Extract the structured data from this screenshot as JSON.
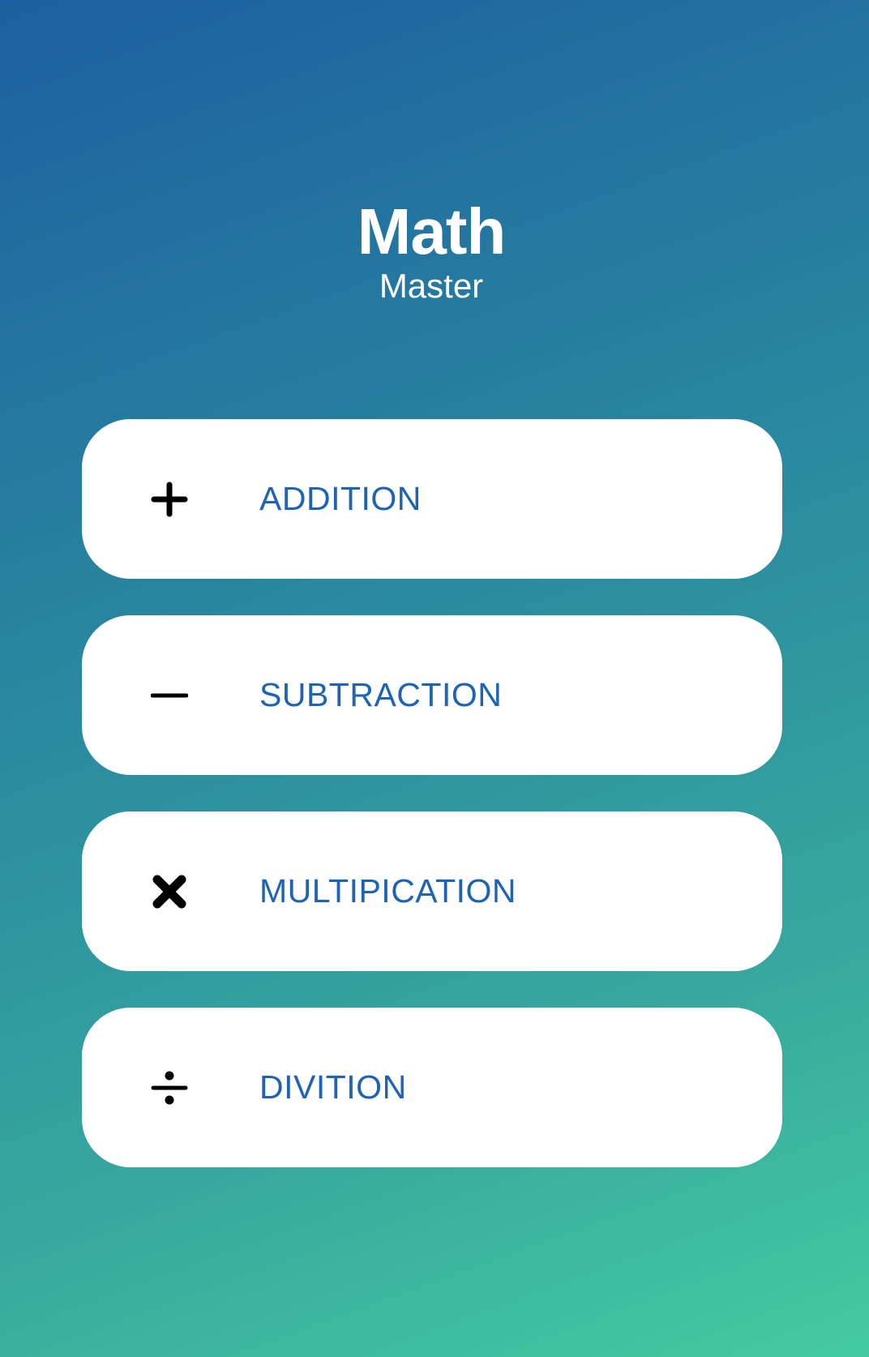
{
  "app": {
    "title": "Math",
    "subtitle": "Master"
  },
  "menu": {
    "items": [
      {
        "label": "ADDITION",
        "icon": "plus-icon"
      },
      {
        "label": "SUBTRACTION",
        "icon": "minus-icon"
      },
      {
        "label": "MULTIPICATION",
        "icon": "multiply-icon"
      },
      {
        "label": "DIVITION",
        "icon": "divide-icon"
      }
    ]
  },
  "colors": {
    "gradient_start": "#1d5fa0",
    "gradient_end": "#43cba0",
    "card_background": "#ffffff",
    "label_color": "#1f63b5",
    "icon_color": "#000000",
    "title_color": "#ffffff"
  }
}
